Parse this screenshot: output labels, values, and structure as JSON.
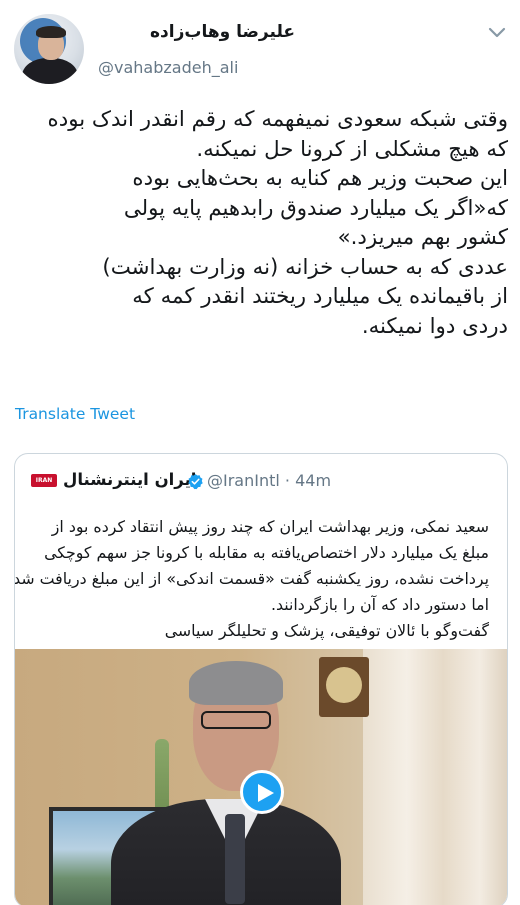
{
  "author": {
    "display_name": "علیرضا وهاب‌زاده",
    "handle": "@vahabzadeh_ali"
  },
  "tweet": {
    "lines": [
      "وقتی شبکه سعودی نمیفهمه که رقم انقدر اندک بوده",
      "که هیچ مشکلی از کرونا حل نمیکنه.",
      "این صحبت وزیر هم کنایه به بحث‌هایی بوده",
      "که«اگر یک میلیارد صندوق رابدهیم پایه پولی",
      "کشور بهم میریزد.»",
      "عددی که به حساب خزانه (نه وزارت بهداشت)",
      "از باقیمانده یک میلیارد ریختند انقدر کمه که",
      "دردی دوا نمیکنه."
    ],
    "translate_label": "Translate Tweet"
  },
  "quoted": {
    "name": "ایران اینترنشنال",
    "handle": "@IranIntl",
    "separator": "·",
    "time": "44m",
    "logo_text": "IRAN INTL",
    "lines": [
      "سعید نمکی، وزیر بهداشت ایران که چند روز پیش انتقاد کرده بود از",
      "مبلغ یک میلیارد دلار اختصاص‌یافته به مقابله با کرونا جز سهم کوچکی",
      "پرداخت نشده، روز یکشنبه گفت «قسمت اندکی» از این مبلغ دریافت شد",
      "اما دستور داد که آن را بازگردانند.",
      "گفت‌وگو با ئالان توفیقی، پزشک و تحلیلگر سیاسی"
    ]
  },
  "icons": {
    "chevron": "chevron-down-icon",
    "verified": "verified-badge-icon",
    "play": "play-icon"
  },
  "colors": {
    "link": "#1b95e0",
    "secondary": "#657786",
    "verified": "#1da1f2"
  }
}
